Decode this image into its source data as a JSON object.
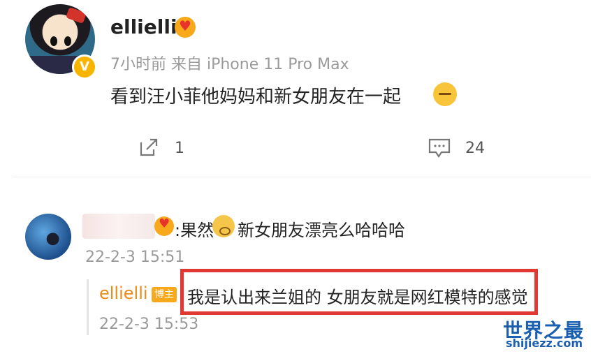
{
  "post": {
    "username": "ellielli",
    "meta": "7小时前  来自 iPhone 11 Pro Max",
    "verify_mark": "V",
    "content": "看到汪小菲他妈妈和新女朋友在一起",
    "share_count": "1",
    "comment_count": "24"
  },
  "comment": {
    "prefix": ":果然",
    "text": "新女朋友漂亮么哈哈哈",
    "time": "22-2-3 15:51",
    "reply": {
      "username": "ellielli",
      "tag": "博主",
      "text": "我是认出来兰姐的 女朋友就是网红模特的感觉",
      "time": "22-2-3 15:53"
    }
  },
  "watermark": {
    "title": "世界之最",
    "url": "shijiezz.com"
  },
  "colors": {
    "highlight_box": "#e23834",
    "reply_username": "#ea8a18",
    "watermark": "#1a5fb0",
    "verify": "#f7b500"
  },
  "icons": [
    "share-icon",
    "comment-icon",
    "heart-badge-icon",
    "sleep-emoji-icon",
    "surprised-emoji-icon"
  ]
}
